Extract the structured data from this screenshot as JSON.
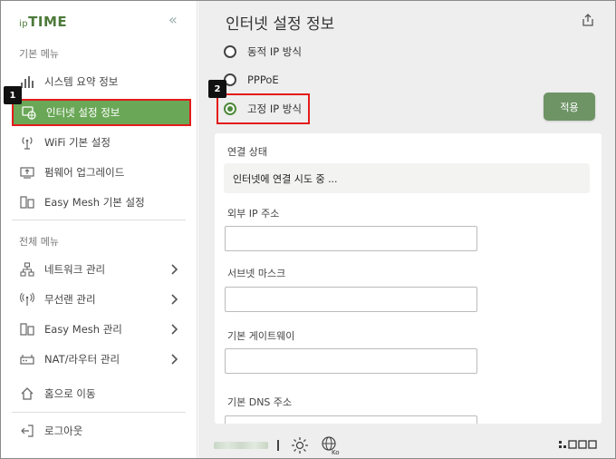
{
  "brand": {
    "logo_prefix": "ip",
    "logo_main": "TIME"
  },
  "sidebar": {
    "collapse_glyph": "«",
    "basic_menu_label": "기본 메뉴",
    "all_menu_label": "전체 메뉴",
    "basic_items": [
      {
        "label": "시스템 요약 정보",
        "icon": "bar-chart-icon"
      },
      {
        "label": "인터넷 설정 정보",
        "icon": "globe-internet-icon",
        "active": true
      },
      {
        "label": "WiFi 기본 설정",
        "icon": "wifi-antenna-icon"
      },
      {
        "label": "펌웨어 업그레이드",
        "icon": "firmware-upgrade-icon"
      },
      {
        "label": "Easy Mesh 기본 설정",
        "icon": "mesh-icon"
      }
    ],
    "all_items": [
      {
        "label": "네트워크 관리",
        "icon": "network-icon"
      },
      {
        "label": "무선랜 관리",
        "icon": "wireless-icon"
      },
      {
        "label": "Easy Mesh 관리",
        "icon": "mesh-icon"
      },
      {
        "label": "NAT/라우터 관리",
        "icon": "router-icon"
      },
      {
        "label": "홈으로 이동",
        "icon": "home-icon"
      },
      {
        "label": "로그아웃",
        "icon": "logout-icon"
      }
    ]
  },
  "annotations": {
    "badge1": "1",
    "badge2": "2"
  },
  "main": {
    "title": "인터넷 설정 정보",
    "connection_types": [
      {
        "label": "동적 IP 방식",
        "selected": false
      },
      {
        "label": "PPPoE",
        "selected": false
      },
      {
        "label": "고정 IP 방식",
        "selected": true
      }
    ],
    "apply_label": "적용",
    "status_label": "연결 상태",
    "status_value": "인터넷에 연결 시도 중 ...",
    "external_ip_label": "외부 IP 주소",
    "external_ip_value": "",
    "subnet_label": "서브넷 마스크",
    "subnet_value": "",
    "gateway_label": "기본 게이트웨이",
    "gateway_value": "",
    "dns_label": "기본 DNS 주소",
    "dns_value": ""
  },
  "footer": {
    "language_badge": "Ko"
  },
  "colors": {
    "accent": "#6aa757",
    "apply": "#6e9466",
    "highlight": "#e31b1b",
    "brand": "#4d7a3a"
  }
}
